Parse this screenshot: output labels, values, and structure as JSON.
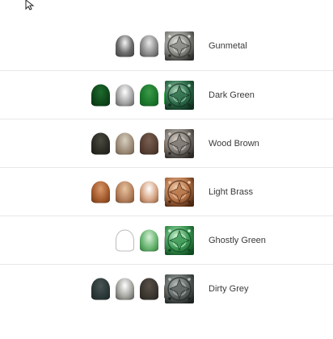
{
  "paints": [
    {
      "name": "Gunmetal",
      "pots": [
        {
          "type": "filled",
          "colors": [
            "#f4f4f4",
            "#6a6a6a",
            "#3c3c3c"
          ]
        },
        {
          "type": "filled",
          "colors": [
            "#e8e8e8",
            "#8f8f8f",
            "#4a4a4a"
          ]
        },
        {
          "type": "filled",
          "colors": [
            "#ffffff",
            "#d9d9d9",
            "#a8a8a8"
          ]
        }
      ],
      "swatch": {
        "base": "#8a8a86",
        "light": "#d8d8d4",
        "dark": "#2e2e2c"
      }
    },
    {
      "name": "Dark Green",
      "pots": [
        {
          "type": "filled",
          "colors": [
            "#1f6b2e",
            "#0f4a1c",
            "#06300f"
          ]
        },
        {
          "type": "filled",
          "colors": [
            "#ffffff",
            "#a8a8a8",
            "#5a5a5a"
          ]
        },
        {
          "type": "filled",
          "colors": [
            "#3b9a4a",
            "#1e7a2e",
            "#0f5c1f"
          ]
        },
        {
          "type": "filled",
          "colors": [
            "#6ad07a",
            "#3cba4e",
            "#2a9a3a"
          ]
        }
      ],
      "swatch": {
        "base": "#2f6f4d",
        "light": "#a9d3b8",
        "dark": "#10301e"
      }
    },
    {
      "name": "Wood Brown",
      "pots": [
        {
          "type": "filled",
          "colors": [
            "#4a4a40",
            "#2e2e26",
            "#1c1c16"
          ]
        },
        {
          "type": "filled",
          "colors": [
            "#d8cfc0",
            "#a0907c",
            "#6e5e4c"
          ]
        },
        {
          "type": "filled",
          "colors": [
            "#7a6052",
            "#5a4236",
            "#3e2a20"
          ]
        },
        {
          "type": "filled",
          "colors": [
            "#b09a84",
            "#8c7560",
            "#6a5644"
          ]
        }
      ],
      "swatch": {
        "base": "#7f7a74",
        "light": "#cfc8c0",
        "dark": "#2c2824"
      }
    },
    {
      "name": "Light Brass",
      "pots": [
        {
          "type": "filled",
          "colors": [
            "#d99a6c",
            "#a85e30",
            "#6e3614"
          ]
        },
        {
          "type": "filled",
          "colors": [
            "#e8c4a0",
            "#b88460",
            "#7a4e2c"
          ]
        },
        {
          "type": "filled",
          "colors": [
            "#ffffff",
            "#d8a888",
            "#8a5a3a"
          ]
        },
        {
          "type": "filled",
          "colors": [
            "#ffffff",
            "#d6d6d6",
            "#9a9a9a"
          ]
        }
      ],
      "swatch": {
        "base": "#b8764a",
        "light": "#f0c8a8",
        "dark": "#4a2610"
      }
    },
    {
      "name": "Ghostly Green",
      "pots": [
        {
          "type": "outline",
          "colors": [
            "#ffffff",
            "#ffffff",
            "#ffffff"
          ]
        },
        {
          "type": "filled",
          "colors": [
            "#d8efd8",
            "#6cb874",
            "#2e7a3a"
          ]
        },
        {
          "type": "outline",
          "colors": [
            "#ffffff",
            "#ffffff",
            "#ffffff"
          ]
        }
      ],
      "swatch": {
        "base": "#3e9a56",
        "light": "#c8f0d0",
        "dark": "#0e4a20"
      }
    },
    {
      "name": "Dirty Grey",
      "pots": [
        {
          "type": "filled",
          "colors": [
            "#4a5656",
            "#2e3a3a",
            "#1c2626"
          ]
        },
        {
          "type": "filled",
          "colors": [
            "#ffffff",
            "#a6a6a2",
            "#54544e"
          ]
        },
        {
          "type": "filled",
          "colors": [
            "#5a524a",
            "#3e3832",
            "#26221e"
          ]
        },
        {
          "type": "filled",
          "colors": [
            "#8e847a",
            "#6e665c",
            "#4e4840"
          ]
        }
      ],
      "swatch": {
        "base": "#5e6462",
        "light": "#b4bab8",
        "dark": "#1e2422"
      }
    }
  ]
}
